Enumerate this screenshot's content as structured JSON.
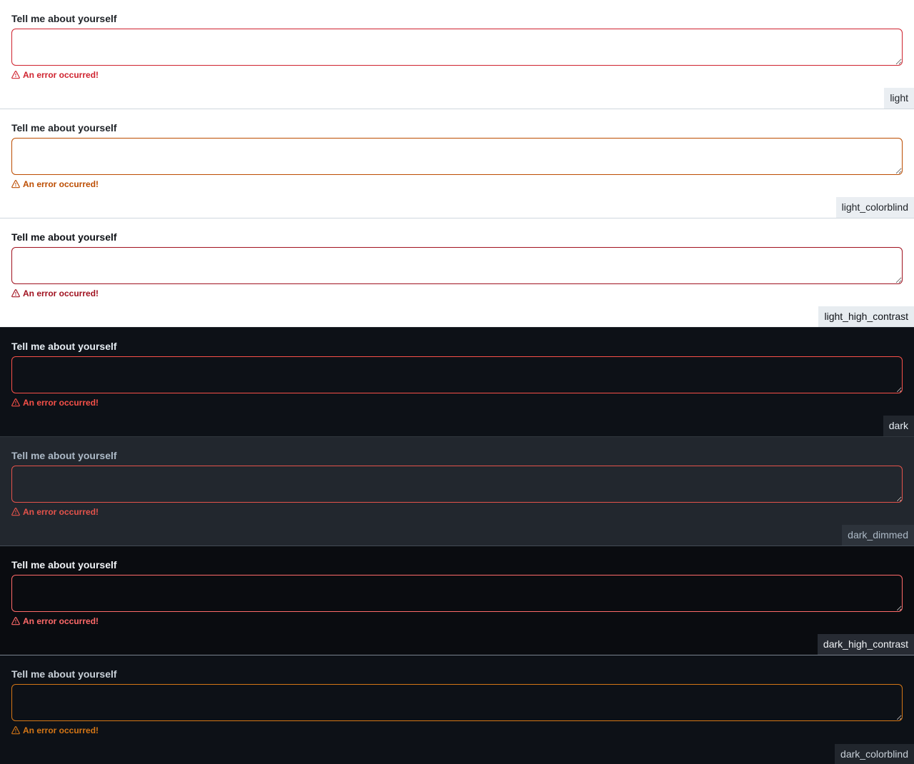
{
  "field": {
    "label": "Tell me about yourself",
    "value": "",
    "validation_message": "An error occurred!"
  },
  "icons": {
    "validation": "alert-triangle-icon"
  },
  "themes": [
    {
      "name": "light",
      "colors": {
        "background": "#ffffff",
        "label": "#1f2328",
        "input_bg": "#ffffff",
        "error": "#cf222e",
        "tag_bg": "#eaeef2",
        "tag_text": "#1f2328",
        "separator": "#d0d7de"
      }
    },
    {
      "name": "light_colorblind",
      "colors": {
        "background": "#ffffff",
        "label": "#1f2328",
        "input_bg": "#ffffff",
        "error": "#bc4c00",
        "tag_bg": "#eaeef2",
        "tag_text": "#1f2328",
        "separator": "#d0d7de"
      }
    },
    {
      "name": "light_high_contrast",
      "colors": {
        "background": "#ffffff",
        "label": "#0e1116",
        "input_bg": "#ffffff",
        "error": "#a0111f",
        "tag_bg": "#e7ecf0",
        "tag_text": "#0e1116",
        "separator": "#20252c"
      }
    },
    {
      "name": "dark",
      "colors": {
        "background": "#0d1117",
        "label": "#e6edf3",
        "input_bg": "#0d1117",
        "error": "#f85149",
        "tag_bg": "#21262d",
        "tag_text": "#e6edf3",
        "separator": "#30363d"
      }
    },
    {
      "name": "dark_dimmed",
      "colors": {
        "background": "#22272e",
        "label": "#adbac7",
        "input_bg": "#22272e",
        "error": "#e5534b",
        "tag_bg": "#2d333b",
        "tag_text": "#adbac7",
        "separator": "#444c56"
      }
    },
    {
      "name": "dark_high_contrast",
      "colors": {
        "background": "#0a0c10",
        "label": "#f0f3f6",
        "input_bg": "#0a0c10",
        "error": "#ff6a69",
        "tag_bg": "#272b33",
        "tag_text": "#f0f3f6",
        "separator": "#7a828e"
      }
    },
    {
      "name": "dark_colorblind",
      "colors": {
        "background": "#0d1117",
        "label": "#c9d1d9",
        "input_bg": "#0d1117",
        "error": "#d47616",
        "tag_bg": "#21262d",
        "tag_text": "#c9d1d9",
        "separator": "#30363d"
      }
    }
  ]
}
